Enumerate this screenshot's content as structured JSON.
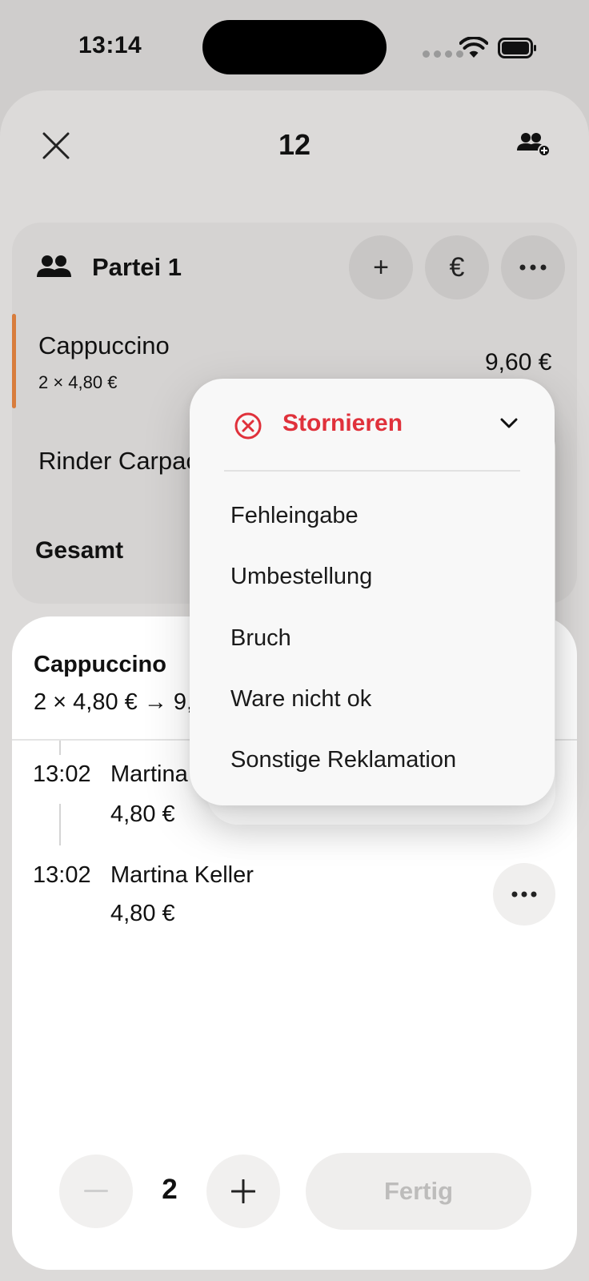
{
  "status_bar": {
    "time": "13:14"
  },
  "header": {
    "title": "12"
  },
  "party": {
    "name": "Partei 1",
    "buttons": {
      "add_symbol": "+",
      "pay_symbol": "€"
    },
    "items": [
      {
        "name": "Cappuccino",
        "detail": "2 × 4,80 €",
        "price": "9,60 €"
      },
      {
        "name": "Rinder Carpaccio"
      }
    ],
    "total_label": "Gesamt"
  },
  "detail": {
    "title": "Cappuccino",
    "subtitle": "2 × 4,80 € → 9,60 €",
    "entries": [
      {
        "time": "13:02",
        "name": "Martina Keller",
        "amount": "4,80 €"
      },
      {
        "time": "13:02",
        "name": "Martina Keller",
        "amount": "4,80 €"
      }
    ]
  },
  "controls": {
    "quantity": "2",
    "done_label": "Fertig"
  },
  "menu": {
    "header_label": "Stornieren",
    "items": [
      "Fehleingabe",
      "Umbestellung",
      "Bruch",
      "Ware nicht ok",
      "Sonstige Reklamation"
    ]
  },
  "colors": {
    "accent": "#d87c3c",
    "destructive": "#e0313b"
  }
}
